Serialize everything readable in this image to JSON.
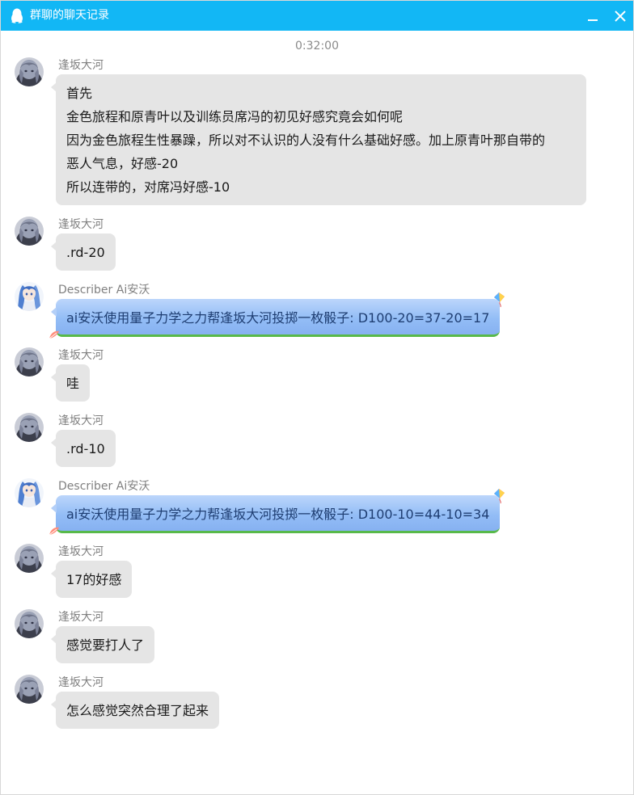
{
  "window": {
    "title": "群聊的聊天记录"
  },
  "timestamp": "0:32:00",
  "messages": [
    {
      "sender": "逢坂大河",
      "type": "user",
      "lines": [
        "首先",
        "金色旅程和原青叶以及训练员席冯的初见好感究竟会如何呢",
        "因为金色旅程生性暴躁，所以对不认识的人没有什么基础好感。加上原青叶那自带的",
        "恶人气息，好感-20",
        "所以连带的，对席冯好感-10"
      ]
    },
    {
      "sender": "逢坂大河",
      "type": "user",
      "lines": [
        ".rd-20"
      ]
    },
    {
      "sender": "Describer Ai安沃",
      "type": "bot",
      "lines": [
        "ai安沃使用量子力学之力帮逢坂大河投掷一枚骰子: D100-20=37-20=17"
      ]
    },
    {
      "sender": "逢坂大河",
      "type": "user",
      "lines": [
        "哇"
      ]
    },
    {
      "sender": "逢坂大河",
      "type": "user",
      "lines": [
        ".rd-10"
      ]
    },
    {
      "sender": "Describer Ai安沃",
      "type": "bot",
      "lines": [
        "ai安沃使用量子力学之力帮逢坂大河投掷一枚骰子: D100-10=44-10=34"
      ]
    },
    {
      "sender": "逢坂大河",
      "type": "user",
      "lines": [
        "17的好感"
      ]
    },
    {
      "sender": "逢坂大河",
      "type": "user",
      "lines": [
        "感觉要打人了"
      ]
    },
    {
      "sender": "逢坂大河",
      "type": "user",
      "lines": [
        "怎么感觉突然合理了起来"
      ]
    }
  ],
  "icons": {
    "title": "qq-penguin-icon",
    "minimize": "minimize-icon",
    "close": "close-icon",
    "user_avatar": "avatar-gray-hair",
    "bot_avatar": "avatar-blue-hair",
    "bubble_decoration": "kite-icon"
  },
  "colors": {
    "titlebar": "#12b7f5",
    "user_bubble": "#e5e5e5",
    "bot_bubble": "#93bdf6",
    "bot_bubble_border": "#58b94a"
  }
}
